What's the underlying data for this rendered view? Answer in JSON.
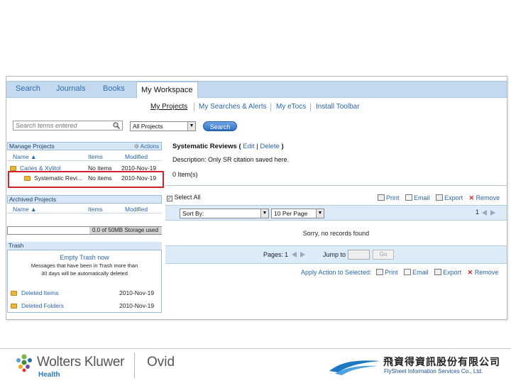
{
  "tabs": [
    "Search",
    "Journals",
    "Books",
    "My Workspace"
  ],
  "subnav": [
    "My Projects",
    "My Searches & Alerts",
    "My eTocs",
    "Install Toolbar"
  ],
  "search": {
    "placeholder": "Search terms entered",
    "scope": "All Projects",
    "button": "Search"
  },
  "manage": {
    "title": "Manage Projects",
    "actions": "Actions",
    "cols": [
      "Name ▲",
      "Items",
      "Modified"
    ],
    "rows": [
      {
        "name": "Caries & Xylitol",
        "items": "No items",
        "modified": "2010-Nov-19"
      },
      {
        "name": "Systematic Revi...",
        "items": "No items",
        "modified": "2010-Nov-19"
      }
    ]
  },
  "archived": {
    "title": "Archived Projects",
    "cols": [
      "Name ▲",
      "Items",
      "Modified"
    ]
  },
  "storage": {
    "text": "0.0 of 50MB Storage used",
    "fraction": 0.0
  },
  "trash": {
    "title": "Trash",
    "empty": "Empty Trash now",
    "msg1": "Messages that have been in Trash more than",
    "msg2": "30 days will be automatically deleted",
    "items": [
      {
        "name": "Deleted Items",
        "date": "2010-Nov-19"
      },
      {
        "name": "Deleted Folders",
        "date": "2010-Nov-19"
      }
    ]
  },
  "project": {
    "title": "Systematic Reviews",
    "open": "(",
    "edit": "Edit",
    "sep": "|",
    "delete": "Delete",
    "close": ")",
    "desc": "Description: Only SR citation saved here.",
    "count": "0 Item(s)"
  },
  "toolbar": {
    "select_all": "Select All",
    "print": "Print",
    "email": "Email",
    "export": "Export",
    "remove": "Remove",
    "sort": "Sort By:",
    "perpage": "10 Per Page",
    "page": "1",
    "empty_msg": "Sorry, no records found",
    "pages_label": "Pages:",
    "pages_value": "1",
    "jump": "Jump to",
    "go": "Go",
    "apply": "Apply Action to Selected:"
  },
  "footer": {
    "brand": "Wolters Kluwer",
    "health": "Health",
    "ovid": "Ovid",
    "cn": "飛資得資訊股份有限公司",
    "en": "FlySheet Information Services Co., Ltd."
  },
  "colors": {
    "accent": "#2a65a8",
    "highlight": "#d2222b"
  }
}
